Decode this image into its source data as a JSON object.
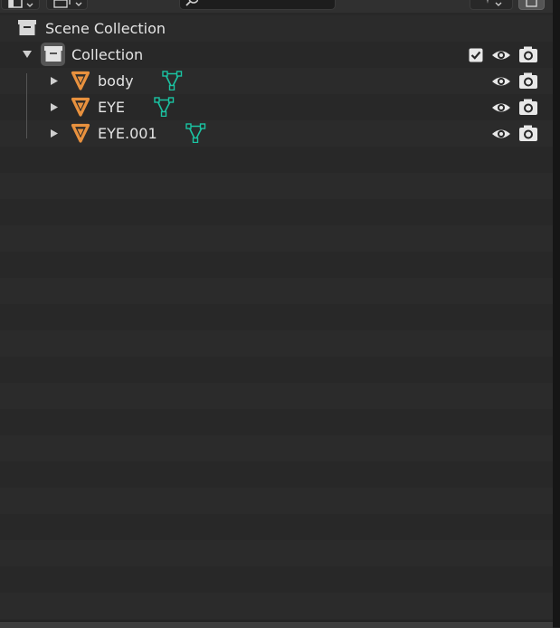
{
  "outliner": {
    "scene_collection": {
      "label": "Scene Collection",
      "icon": "scene-collection-icon"
    },
    "collection": {
      "label": "Collection",
      "icon": "collection-icon",
      "expanded": true,
      "exclude_checkbox": true,
      "visible": true,
      "renderable": true
    },
    "objects": [
      {
        "label": "body",
        "icon": "mesh-object-icon",
        "data_icon": "mesh-data-icon",
        "visible": true,
        "renderable": true
      },
      {
        "label": "EYE",
        "icon": "mesh-object-icon",
        "data_icon": "mesh-data-icon",
        "visible": true,
        "renderable": true
      },
      {
        "label": "EYE.001",
        "icon": "mesh-object-icon",
        "data_icon": "mesh-data-icon",
        "visible": true,
        "renderable": true
      }
    ]
  },
  "colors": {
    "object_orange": "#e8913e",
    "mesh_teal": "#1bc3a2",
    "row_light": "#2b2b2b",
    "row_dark": "#282828",
    "text": "#e4e4e4"
  }
}
